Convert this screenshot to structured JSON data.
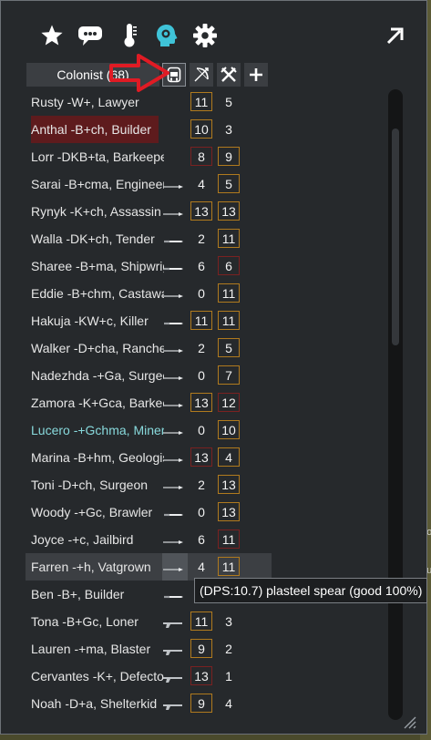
{
  "tabs": [
    {
      "name": "star-icon"
    },
    {
      "name": "speech-bubble-icon"
    },
    {
      "name": "thermometer-icon"
    },
    {
      "name": "head-gear-icon"
    },
    {
      "name": "gear-icon"
    }
  ],
  "expand_icon": "expand-arrow-icon",
  "header": {
    "colonist_label": "Colonist (68)",
    "buttons": [
      "chair-icon",
      "bow-icon",
      "crossed-swords-icon",
      "plus-icon"
    ]
  },
  "rows": [
    {
      "name": "Rusty -W+, Lawyer",
      "weapon": "",
      "v1": "11",
      "v2": "5",
      "b1": "o",
      "b2": "",
      "style": ""
    },
    {
      "name": "Anthal -B+ch, Builder",
      "weapon": "",
      "v1": "10",
      "v2": "3",
      "b1": "o",
      "b2": "",
      "style": "red"
    },
    {
      "name": "Lorr -DKB+ta, Barkeeper",
      "weapon": "",
      "v1": "8",
      "v2": "9",
      "b1": "r",
      "b2": "o",
      "style": ""
    },
    {
      "name": "Sarai -B+cma, Engineer",
      "weapon": "spear",
      "v1": "4",
      "v2": "5",
      "b1": "",
      "b2": "o",
      "style": ""
    },
    {
      "name": "Rynyk -K+ch, Assassin",
      "weapon": "spear",
      "v1": "13",
      "v2": "13",
      "b1": "o",
      "b2": "o",
      "style": ""
    },
    {
      "name": "Walla -DK+ch, Tender",
      "weapon": "knife",
      "v1": "2",
      "v2": "11",
      "b1": "",
      "b2": "o",
      "style": ""
    },
    {
      "name": "Sharee -B+ma, Shipwright",
      "weapon": "knife",
      "v1": "6",
      "v2": "6",
      "b1": "",
      "b2": "r",
      "style": ""
    },
    {
      "name": "Eddie -B+chm, Castaway",
      "weapon": "spear",
      "v1": "0",
      "v2": "11",
      "b1": "",
      "b2": "o",
      "style": ""
    },
    {
      "name": "Hakuja -KW+c, Killer",
      "weapon": "knife",
      "v1": "11",
      "v2": "11",
      "b1": "o",
      "b2": "o",
      "style": ""
    },
    {
      "name": "Walker -D+cha, Rancher",
      "weapon": "spear",
      "v1": "2",
      "v2": "5",
      "b1": "",
      "b2": "o",
      "style": ""
    },
    {
      "name": "Nadezhda -+Ga, Surgeon",
      "weapon": "spear",
      "v1": "0",
      "v2": "7",
      "b1": "",
      "b2": "o",
      "style": ""
    },
    {
      "name": "Zamora -K+Gca, Barkeeper",
      "weapon": "spear",
      "v1": "13",
      "v2": "12",
      "b1": "o",
      "b2": "r",
      "style": ""
    },
    {
      "name": "Lucero -+Gchma, Miner",
      "weapon": "spear",
      "v1": "0",
      "v2": "10",
      "b1": "",
      "b2": "o",
      "style": "cyan"
    },
    {
      "name": "Marina -B+hm, Geologist",
      "weapon": "spear",
      "v1": "13",
      "v2": "4",
      "b1": "r",
      "b2": "o",
      "style": ""
    },
    {
      "name": "Toni -D+ch, Surgeon",
      "weapon": "spear",
      "v1": "2",
      "v2": "13",
      "b1": "",
      "b2": "o",
      "style": ""
    },
    {
      "name": "Woody -+Gc, Brawler",
      "weapon": "knife",
      "v1": "0",
      "v2": "13",
      "b1": "",
      "b2": "o",
      "style": ""
    },
    {
      "name": "Joyce -+c, Jailbird",
      "weapon": "spear",
      "v1": "6",
      "v2": "11",
      "b1": "",
      "b2": "r",
      "style": ""
    },
    {
      "name": "Farren -+h, Vatgrown",
      "weapon": "spear",
      "v1": "4",
      "v2": "11",
      "b1": "",
      "b2": "o",
      "style": "hl"
    },
    {
      "name": "Ben -B+, Builder",
      "weapon": "knife",
      "v1": "",
      "v2": "",
      "b1": "",
      "b2": "",
      "style": ""
    },
    {
      "name": "Tona -B+Gc, Loner",
      "weapon": "gun",
      "v1": "11",
      "v2": "3",
      "b1": "o",
      "b2": "",
      "style": ""
    },
    {
      "name": "Lauren -+ma, Blaster",
      "weapon": "gun",
      "v1": "9",
      "v2": "2",
      "b1": "o",
      "b2": "",
      "style": ""
    },
    {
      "name": "Cervantes -K+, Defector",
      "weapon": "gun",
      "v1": "13",
      "v2": "1",
      "b1": "r",
      "b2": "",
      "style": ""
    },
    {
      "name": "Noah -D+a, Shelterkid",
      "weapon": "gun",
      "v1": "9",
      "v2": "4",
      "b1": "o",
      "b2": "",
      "style": ""
    }
  ],
  "tooltip": "(DPS:10.7) plasteel spear (good 100%)",
  "colors": {
    "accent": "#3fc3d8",
    "arrow": "#e01b24",
    "orange_border": "#b07a1e",
    "red_border": "#7a2121"
  },
  "side_texts": [
    "oo",
    "ou"
  ]
}
